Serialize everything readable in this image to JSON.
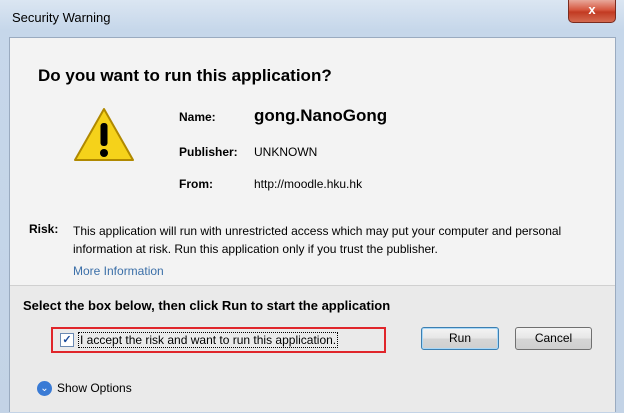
{
  "window": {
    "title": "Security Warning",
    "close_glyph": "x"
  },
  "dialog": {
    "heading": "Do you want to run this application?",
    "fields": {
      "name_label": "Name:",
      "name_value": "gong.NanoGong",
      "publisher_label": "Publisher:",
      "publisher_value": "UNKNOWN",
      "from_label": "From:",
      "from_value": "http://moodle.hku.hk"
    },
    "risk": {
      "label": "Risk:",
      "text": "This application will run with unrestricted access which may put your computer and personal information at risk. Run this application only if you trust the publisher.",
      "more_info": "More Information"
    },
    "prompt": {
      "heading": "Select the box below, then click Run to start the application",
      "checkbox_label": "I accept the risk and want to run this application.",
      "checkbox_checked": true,
      "checkmark_glyph": "✓"
    },
    "buttons": {
      "run": "Run",
      "cancel": "Cancel"
    },
    "show_options": {
      "label": "Show Options",
      "icon": "chevron-down-icon",
      "glyph": "⌄"
    }
  },
  "colors": {
    "highlight_border": "#e0262b",
    "link": "#3b6fa8",
    "warning_yellow": "#f5d21a"
  }
}
